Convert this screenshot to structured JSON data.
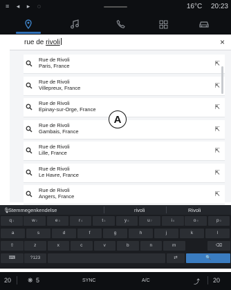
{
  "status": {
    "left_icons": "≡ ◂ ▸ ◌",
    "temperature": "16°C",
    "time": "20:23"
  },
  "nav": {
    "items": [
      {
        "name": "navigation",
        "icon": "location-pin-icon"
      },
      {
        "name": "music",
        "icon": "music-note-icon"
      },
      {
        "name": "phone",
        "icon": "phone-icon"
      },
      {
        "name": "apps",
        "icon": "grid-icon"
      },
      {
        "name": "vehicle",
        "icon": "car-icon"
      }
    ],
    "active_color": "#3f84c8"
  },
  "search": {
    "query_prefix": "rue de ",
    "query_underlined": "rivoli",
    "close_label": "×"
  },
  "results": [
    {
      "name": "Rue de Rivoli",
      "place": "Paris, France"
    },
    {
      "name": "Rue de Rivoli",
      "place": "Villepreux, France"
    },
    {
      "name": "Rue de Rivoli",
      "place": "Epinay-sur-Orge, France"
    },
    {
      "name": "Rue de Rivoli",
      "place": "Gambais, France"
    },
    {
      "name": "Rue de Rivoli",
      "place": "Lille, France"
    },
    {
      "name": "Rue de Rivoli",
      "place": "Le Havre, France"
    },
    {
      "name": "Rue de Rivoli",
      "place": "Angers, France"
    }
  ],
  "marker_label": "A",
  "keyboard": {
    "suggestions": [
      "Stemmegenkendelse",
      "rivoli",
      "Rivoli"
    ],
    "row1": [
      "q",
      "w",
      "e",
      "r",
      "t",
      "y",
      "u",
      "i",
      "o",
      "p"
    ],
    "row1_sup": [
      "1",
      "2",
      "3",
      "4",
      "5",
      "6",
      "7",
      "8",
      "9",
      "0"
    ],
    "row2": [
      "a",
      "s",
      "d",
      "f",
      "g",
      "h",
      "j",
      "k",
      "l"
    ],
    "row3": [
      "z",
      "x",
      "c",
      "v",
      "b",
      "n",
      "m"
    ],
    "symbols_label": "?123",
    "search_key_color": "#3a7cc0"
  },
  "bottom": {
    "left_temp": "20",
    "fan": "5",
    "sync": "SYNC",
    "ac": "A/C",
    "right_temp": "20"
  }
}
